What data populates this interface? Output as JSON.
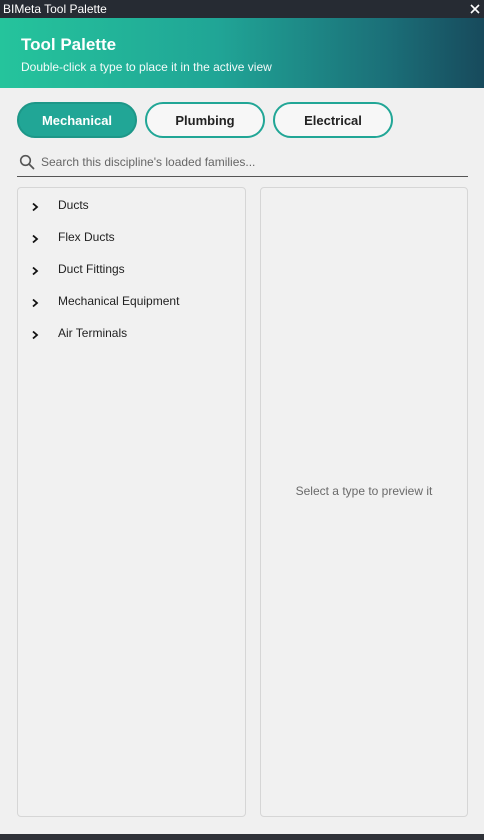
{
  "window": {
    "title": "BIMeta Tool Palette",
    "close_icon": "close-icon"
  },
  "header": {
    "title": "Tool Palette",
    "subtitle": "Double-click a type to place it in the active view"
  },
  "tabs": [
    {
      "label": "Mechanical",
      "active": true
    },
    {
      "label": "Plumbing",
      "active": false
    },
    {
      "label": "Electrical",
      "active": false
    }
  ],
  "search": {
    "placeholder": "Search this discipline's loaded families...",
    "value": "",
    "icon": "search-icon"
  },
  "tree": {
    "items": [
      {
        "label": "Ducts",
        "icon": "chevron-right-icon"
      },
      {
        "label": "Flex Ducts",
        "icon": "chevron-right-icon"
      },
      {
        "label": "Duct Fittings",
        "icon": "chevron-right-icon"
      },
      {
        "label": "Mechanical Equipment",
        "icon": "chevron-right-icon"
      },
      {
        "label": "Air Terminals",
        "icon": "chevron-right-icon"
      }
    ]
  },
  "preview": {
    "placeholder": "Select a type to preview it"
  },
  "colors": {
    "accent": "#21a696",
    "header_start": "#25c49c",
    "header_end": "#174a5c",
    "titlebar": "#262b33"
  }
}
